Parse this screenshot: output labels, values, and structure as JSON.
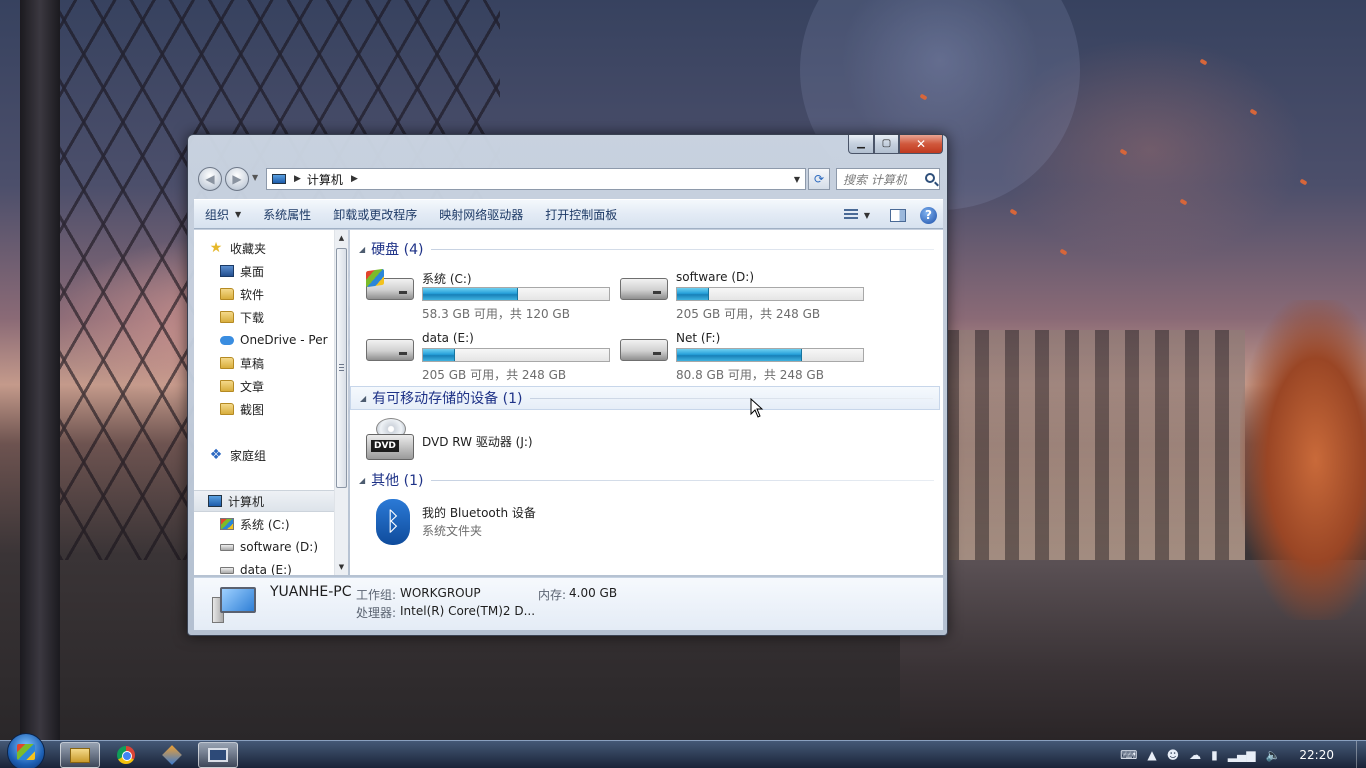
{
  "window": {
    "address": {
      "crumb": "计算机"
    },
    "search": {
      "placeholder": "搜索 计算机"
    },
    "toolbar": {
      "organize": "组织",
      "system_properties": "系统属性",
      "uninstall": "卸载或更改程序",
      "map_drive": "映射网络驱动器",
      "control_panel": "打开控制面板"
    },
    "navpane": {
      "items": [
        {
          "label": "收藏夹",
          "icon": "star-icon"
        },
        {
          "label": "桌面",
          "icon": "desktop-icon"
        },
        {
          "label": "软件",
          "icon": "folder-icon"
        },
        {
          "label": "下载",
          "icon": "folder-icon"
        },
        {
          "label": "OneDrive - Per",
          "icon": "onedrive-icon"
        },
        {
          "label": "草稿",
          "icon": "folder-icon"
        },
        {
          "label": "文章",
          "icon": "folder-icon"
        },
        {
          "label": "截图",
          "icon": "folder-icon"
        },
        {
          "label": "家庭组",
          "icon": "homegroup-icon"
        },
        {
          "label": "计算机",
          "icon": "computer-icon"
        },
        {
          "label": "系统 (C:)",
          "icon": "windows-drive-icon"
        },
        {
          "label": "software (D:)",
          "icon": "drive-icon"
        },
        {
          "label": "data (E:)",
          "icon": "drive-icon"
        }
      ]
    },
    "groups": {
      "hard_disks": "硬盘 (4)",
      "removable": "有可移动存储的设备 (1)",
      "other": "其他 (1)"
    },
    "drives": [
      {
        "name": "系统 (C:)",
        "free_text": "58.3 GB 可用，共 120 GB",
        "used_fraction": 0.51
      },
      {
        "name": "software (D:)",
        "free_text": "205 GB 可用，共 248 GB",
        "used_fraction": 0.17
      },
      {
        "name": "data (E:)",
        "free_text": "205 GB 可用，共 248 GB",
        "used_fraction": 0.17
      },
      {
        "name": "Net (F:)",
        "free_text": "80.8 GB 可用，共 248 GB",
        "used_fraction": 0.67
      }
    ],
    "dvd": {
      "name": "DVD RW 驱动器 (J:)",
      "badge": "DVD"
    },
    "bluetooth": {
      "name": "我的 Bluetooth 设备",
      "type": "系统文件夹"
    },
    "details": {
      "pc_name": "YUANHE-PC",
      "workgroup_label": "工作组:",
      "workgroup_value": "WORKGROUP",
      "memory_label": "内存:",
      "memory_value": "4.00 GB",
      "cpu_label": "处理器:",
      "cpu_value": "Intel(R) Core(TM)2 D..."
    }
  },
  "taskbar": {
    "clock": "22:20",
    "apps": [
      "explorer-icon",
      "chrome-icon",
      "app-icon",
      "remote-desktop-icon"
    ]
  },
  "colors": {
    "drive_fill": "#26a0da",
    "group_title": "#1e3287",
    "close_button": "#c0391f"
  }
}
